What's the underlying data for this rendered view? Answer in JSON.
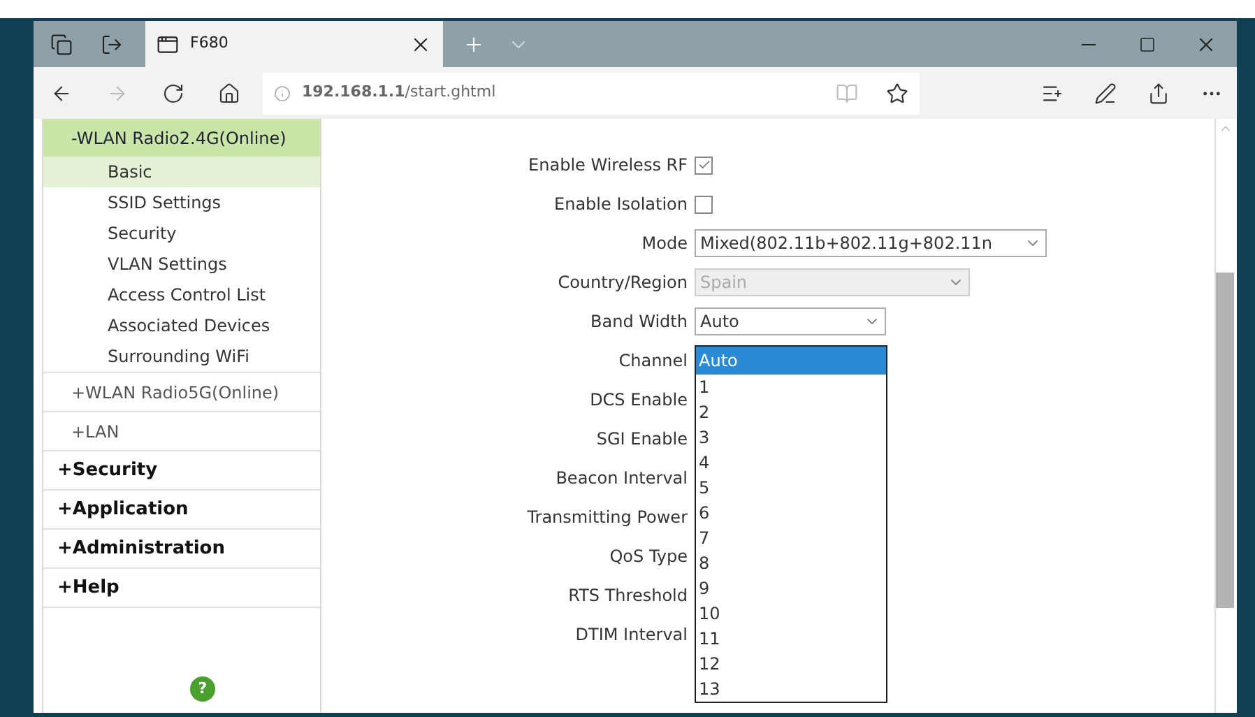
{
  "browser": {
    "tab": {
      "title": "F680"
    },
    "address": "**192.168.1.1**/start.ghtml"
  },
  "sidebar": {
    "items": [
      {
        "label": "-WLAN Radio2.4G(Online)",
        "kind": "group",
        "expanded": true,
        "children": [
          {
            "label": "Basic",
            "selected": true
          },
          {
            "label": "SSID Settings",
            "selected": false
          },
          {
            "label": "Security",
            "selected": false
          },
          {
            "label": "VLAN Settings",
            "selected": false
          },
          {
            "label": "Access Control List",
            "selected": false
          },
          {
            "label": "Associated Devices",
            "selected": false
          },
          {
            "label": "Surrounding WiFi",
            "selected": false
          }
        ]
      },
      {
        "label": "+WLAN Radio5G(Online)",
        "kind": "group",
        "expanded": false
      },
      {
        "label": "+LAN",
        "kind": "group",
        "expanded": false
      },
      {
        "label": "+Security",
        "kind": "section"
      },
      {
        "label": "+Application",
        "kind": "section"
      },
      {
        "label": "+Administration",
        "kind": "section"
      },
      {
        "label": "+Help",
        "kind": "section"
      }
    ],
    "help": "?"
  },
  "form": {
    "rows": [
      {
        "label": "Enable Wireless RF",
        "kind": "checkbox",
        "checked": true
      },
      {
        "label": "Enable Isolation",
        "kind": "checkbox",
        "checked": false
      },
      {
        "label": "Mode",
        "kind": "select",
        "value": "Mixed(802.11b+802.11g+802.11n",
        "disabled": false
      },
      {
        "label": "Country/Region",
        "kind": "select",
        "value": "Spain",
        "disabled": true
      },
      {
        "label": "Band Width",
        "kind": "select",
        "value": "Auto",
        "disabled": false
      },
      {
        "label": "Channel",
        "kind": "open-list",
        "options": [
          {
            "label": "Auto",
            "selected": true
          },
          {
            "label": "1",
            "selected": false
          },
          {
            "label": "2",
            "selected": false
          },
          {
            "label": "3",
            "selected": false
          },
          {
            "label": "4",
            "selected": false
          },
          {
            "label": "5",
            "selected": false
          },
          {
            "label": "6",
            "selected": false
          },
          {
            "label": "7",
            "selected": false
          },
          {
            "label": "8",
            "selected": false
          },
          {
            "label": "9",
            "selected": false
          },
          {
            "label": "10",
            "selected": false
          },
          {
            "label": "11",
            "selected": false
          },
          {
            "label": "12",
            "selected": false
          },
          {
            "label": "13",
            "selected": false
          }
        ]
      },
      {
        "label": "DCS Enable",
        "kind": "covered"
      },
      {
        "label": "SGI Enable",
        "kind": "covered"
      },
      {
        "label": "Beacon Interval",
        "kind": "covered"
      },
      {
        "label": "Transmitting Power",
        "kind": "covered"
      },
      {
        "label": "QoS Type",
        "kind": "covered"
      },
      {
        "label": "RTS Threshold",
        "kind": "covered"
      },
      {
        "label": "DTIM Interval",
        "kind": "covered"
      }
    ]
  }
}
